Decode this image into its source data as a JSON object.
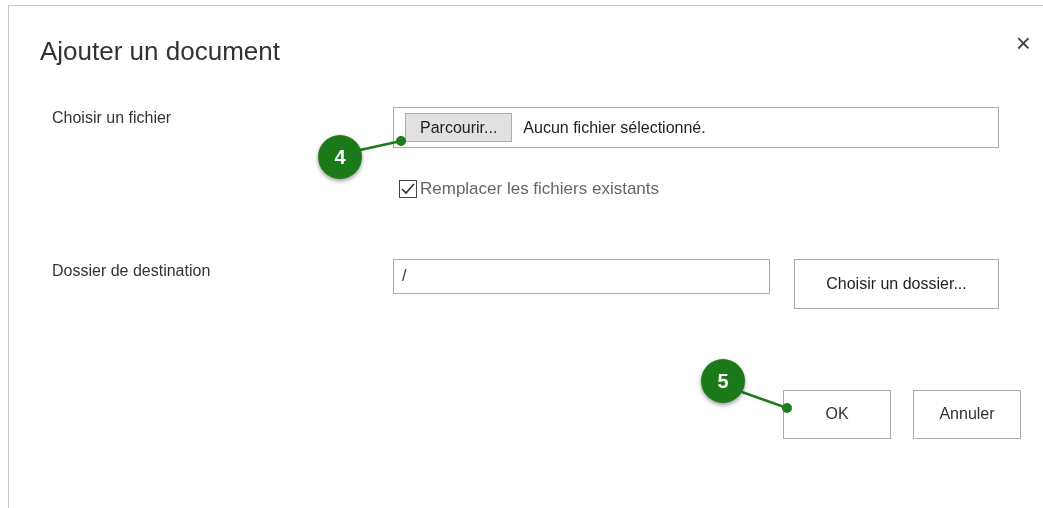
{
  "dialog": {
    "title": "Ajouter un document",
    "close": "×"
  },
  "file_row": {
    "label": "Choisir un fichier",
    "browse_button": "Parcourir...",
    "file_status": "Aucun fichier sélectionné.",
    "replace": {
      "label": "Remplacer les fichiers existants",
      "checked": true
    }
  },
  "folder_row": {
    "label": "Dossier de destination",
    "value": "/",
    "button": "Choisir un dossier..."
  },
  "buttons": [
    "OK",
    "Annuler"
  ],
  "callouts": [
    {
      "number": "4"
    },
    {
      "number": "5"
    }
  ]
}
